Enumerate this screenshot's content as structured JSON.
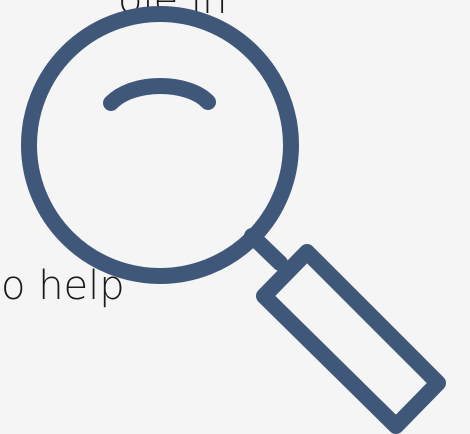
{
  "text_fragments": {
    "top": "ole in",
    "bottom": "o help"
  },
  "icon": {
    "name": "magnifying-glass-icon",
    "stroke_color": "#3f587a"
  },
  "colors": {
    "background": "#f5f5f5",
    "text": "#1a1a1a"
  }
}
